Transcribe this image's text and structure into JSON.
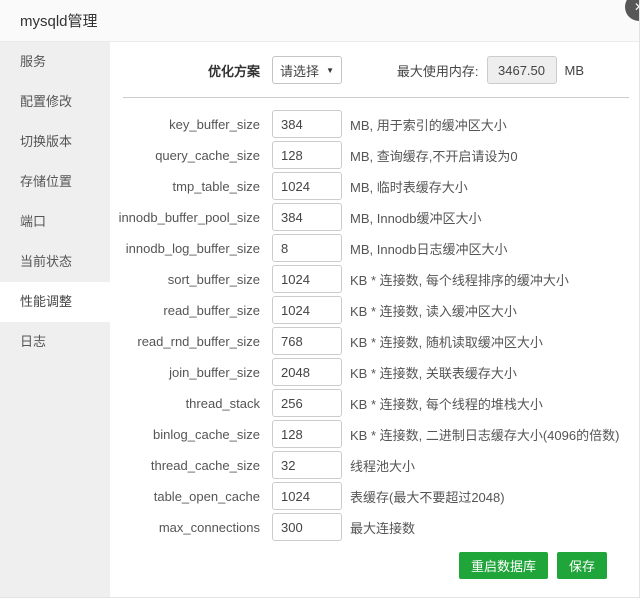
{
  "window": {
    "title": "mysqld管理",
    "close_glyph": "✕"
  },
  "sidebar": {
    "items": [
      {
        "label": "服务",
        "active": false
      },
      {
        "label": "配置修改",
        "active": false
      },
      {
        "label": "切换版本",
        "active": false
      },
      {
        "label": "存储位置",
        "active": false
      },
      {
        "label": "端口",
        "active": false
      },
      {
        "label": "当前状态",
        "active": false
      },
      {
        "label": "性能调整",
        "active": true
      },
      {
        "label": "日志",
        "active": false
      }
    ]
  },
  "optimizer": {
    "label": "优化方案",
    "selected_value": "请选择",
    "arrow_glyph": "▼"
  },
  "memory": {
    "label": "最大使用内存:",
    "value": "3467.50",
    "unit": "MB"
  },
  "params": {
    "rows": [
      {
        "name": "key_buffer_size",
        "value": "384",
        "hint": "MB, 用于索引的缓冲区大小"
      },
      {
        "name": "query_cache_size",
        "value": "128",
        "hint": "MB, 查询缓存,不开启请设为0"
      },
      {
        "name": "tmp_table_size",
        "value": "1024",
        "hint": "MB, 临时表缓存大小"
      },
      {
        "name": "innodb_buffer_pool_size",
        "value": "384",
        "hint": "MB, Innodb缓冲区大小"
      },
      {
        "name": "innodb_log_buffer_size",
        "value": "8",
        "hint": "MB, Innodb日志缓冲区大小"
      },
      {
        "name": "sort_buffer_size",
        "value": "1024",
        "hint": "KB * 连接数, 每个线程排序的缓冲大小"
      },
      {
        "name": "read_buffer_size",
        "value": "1024",
        "hint": "KB * 连接数, 读入缓冲区大小"
      },
      {
        "name": "read_rnd_buffer_size",
        "value": "768",
        "hint": "KB * 连接数, 随机读取缓冲区大小"
      },
      {
        "name": "join_buffer_size",
        "value": "2048",
        "hint": "KB * 连接数, 关联表缓存大小"
      },
      {
        "name": "thread_stack",
        "value": "256",
        "hint": "KB * 连接数, 每个线程的堆栈大小"
      },
      {
        "name": "binlog_cache_size",
        "value": "128",
        "hint": "KB * 连接数, 二进制日志缓存大小(4096的倍数)"
      },
      {
        "name": "thread_cache_size",
        "value": "32",
        "hint": "线程池大小"
      },
      {
        "name": "table_open_cache",
        "value": "1024",
        "hint": "表缓存(最大不要超过2048)"
      },
      {
        "name": "max_connections",
        "value": "300",
        "hint": "最大连接数"
      }
    ]
  },
  "actions": {
    "restart_label": "重启数据库",
    "save_label": "保存"
  },
  "colors": {
    "accent_green": "#20a53a"
  }
}
